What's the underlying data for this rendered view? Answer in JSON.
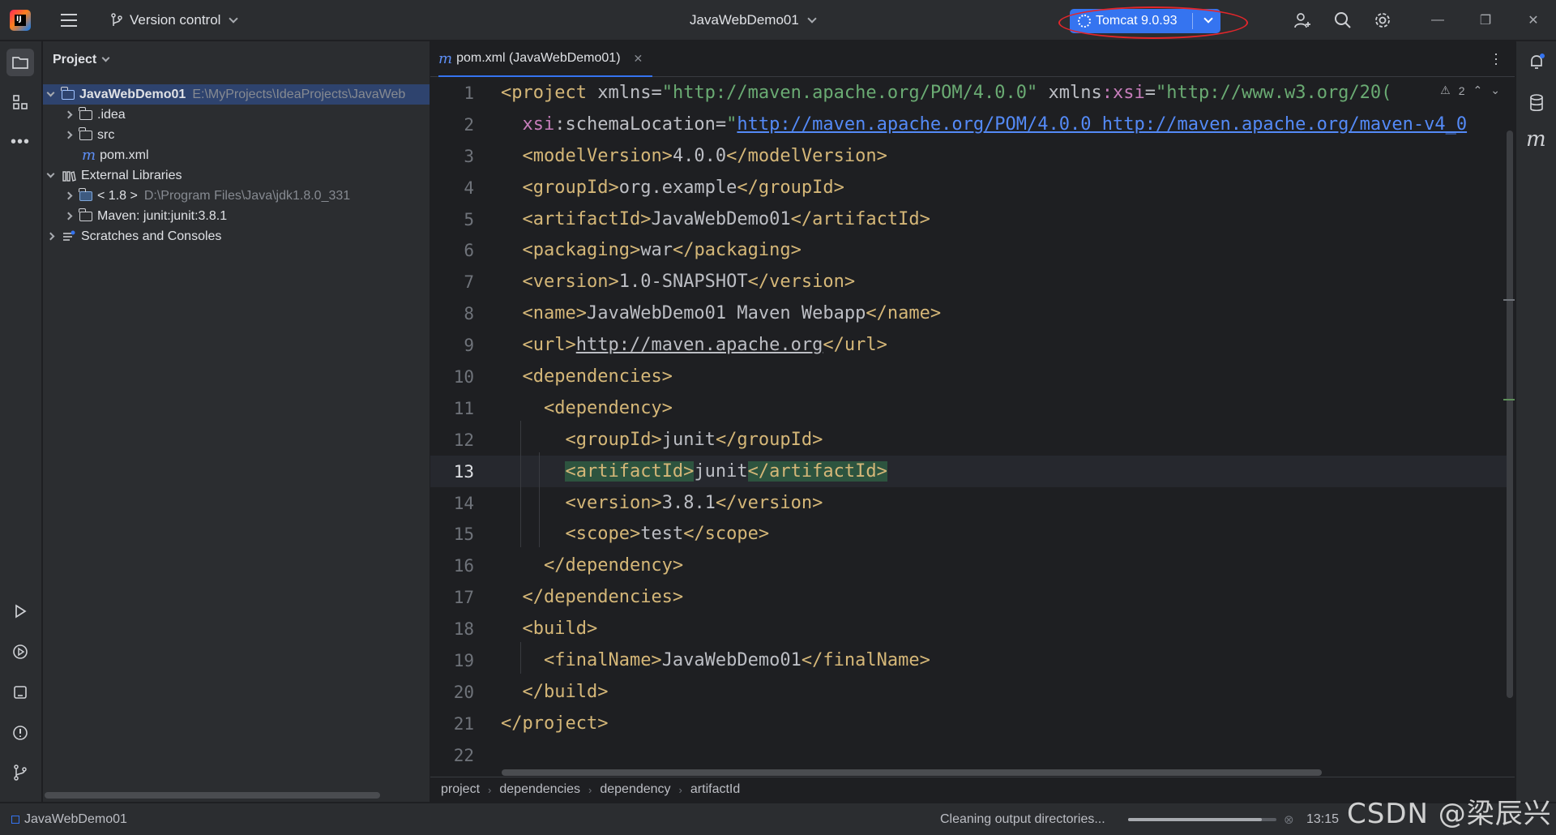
{
  "titlebar": {
    "vcs_label": "Version control",
    "project_name": "JavaWebDemo01",
    "run_config": "Tomcat 9.0.93"
  },
  "project_panel": {
    "title": "Project",
    "tree": [
      {
        "label": "JavaWebDemo01",
        "hint": "E:\\MyProjects\\IdeaProjects\\JavaWeb",
        "icon": "module-folder-icon",
        "expanded": true
      },
      {
        "label": ".idea",
        "icon": "folder-icon"
      },
      {
        "label": "src",
        "icon": "folder-icon"
      },
      {
        "label": "pom.xml",
        "icon": "maven-file-icon"
      },
      {
        "label": "External Libraries",
        "icon": "library-icon",
        "expanded": true
      },
      {
        "label": "< 1.8 >",
        "hint": "D:\\Program Files\\Java\\jdk1.8.0_331",
        "icon": "jdk-folder-icon"
      },
      {
        "label": "Maven: junit:junit:3.8.1",
        "icon": "library-folder-icon"
      },
      {
        "label": "Scratches and Consoles",
        "icon": "scratches-icon"
      }
    ]
  },
  "editor": {
    "tab_label": "pom.xml (JavaWebDemo01)",
    "current_line": 13,
    "warning_count": "2",
    "line_numbers": [
      "1",
      "2",
      "3",
      "4",
      "5",
      "6",
      "7",
      "8",
      "9",
      "10",
      "11",
      "12",
      "13",
      "14",
      "15",
      "16",
      "17",
      "18",
      "19",
      "20",
      "21",
      "22"
    ],
    "lines": {
      "l1_tag": "<project",
      "l1_attr1": " xmlns",
      "l1_val1": "\"http://maven.apache.org/POM/4.0.0\"",
      "l1_attr2": " xmlns",
      "l1_ns": ":xsi",
      "l1_val2": "\"http://www.w3.org/20(",
      "l2_ns": "xsi",
      "l2_attr": ":schemaLocation=",
      "l2_q": "\"",
      "l2_link": "http://maven.apache.org/POM/4.0.0 http://maven.apache.org/maven-v4_0",
      "l3_open": "<modelVersion>",
      "l3_text": "4.0.0",
      "l3_close": "</modelVersion>",
      "l4_open": "<groupId>",
      "l4_text": "org.example",
      "l4_close": "</groupId>",
      "l5_open": "<artifactId>",
      "l5_text": "JavaWebDemo01",
      "l5_close": "</artifactId>",
      "l6_open": "<packaging>",
      "l6_text": "war",
      "l6_close": "</packaging>",
      "l7_open": "<version>",
      "l7_text": "1.0-SNAPSHOT",
      "l7_close": "</version>",
      "l8_open": "<name>",
      "l8_text": "JavaWebDemo01 Maven Webapp",
      "l8_close": "</name>",
      "l9_open": "<url>",
      "l9_link": "http://maven.apache.org",
      "l9_close": "</url>",
      "l10": "<dependencies>",
      "l11": "<dependency>",
      "l12_open": "<groupId>",
      "l12_text": "junit",
      "l12_close": "</groupId>",
      "l13_open": "<artifactId>",
      "l13_text": "junit",
      "l13_close": "</artifactId>",
      "l14_open": "<version>",
      "l14_text": "3.8.1",
      "l14_close": "</version>",
      "l15_open": "<scope>",
      "l15_text": "test",
      "l15_close": "</scope>",
      "l16": "</dependency>",
      "l17": "</dependencies>",
      "l18": "<build>",
      "l19_open": "<finalName>",
      "l19_text": "JavaWebDemo01",
      "l19_close": "</finalName>",
      "l20": "</build>",
      "l21": "</project>"
    },
    "breadcrumbs": [
      "project",
      "dependencies",
      "dependency",
      "artifactId"
    ]
  },
  "statusbar": {
    "project": "JavaWebDemo01",
    "task": "Cleaning output directories...",
    "progress_fraction": 0.9,
    "time": "13:15"
  },
  "watermark": "CSDN @梁辰兴",
  "colors": {
    "accent": "#3574f0",
    "annotation": "#e3262b",
    "tag": "#d5b778",
    "string": "#6aab73",
    "namespace": "#c77dbb"
  }
}
